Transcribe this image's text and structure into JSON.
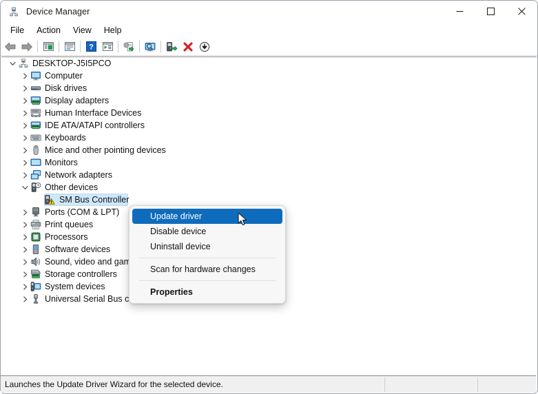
{
  "window": {
    "title": "Device Manager",
    "icon": "device-manager-icon",
    "controls": {
      "minimize": "minimize-icon",
      "maximize": "maximize-icon",
      "close": "close-icon"
    }
  },
  "menubar": {
    "items": [
      {
        "label": "File"
      },
      {
        "label": "Action"
      },
      {
        "label": "View"
      },
      {
        "label": "Help"
      }
    ]
  },
  "toolbar": {
    "buttons": [
      {
        "name": "back-icon",
        "title": "Back"
      },
      {
        "name": "forward-icon",
        "title": "Forward"
      },
      {
        "separator": true
      },
      {
        "name": "show-hide-console-tree-icon",
        "title": "Show/Hide Console Tree"
      },
      {
        "separator": true
      },
      {
        "name": "properties-icon",
        "title": "Properties"
      },
      {
        "separator": true
      },
      {
        "name": "help-icon",
        "title": "Help"
      },
      {
        "name": "show-hide-action-pane-icon",
        "title": "Show/Hide Action Pane"
      },
      {
        "separator": true
      },
      {
        "name": "update-driver-icon",
        "title": "Update driver"
      },
      {
        "separator": true
      },
      {
        "name": "scan-for-hardware-changes-icon",
        "title": "Scan for hardware changes"
      },
      {
        "separator": true
      },
      {
        "name": "enable-device-icon",
        "title": "Enable device"
      },
      {
        "name": "uninstall-device-icon",
        "title": "Uninstall device"
      },
      {
        "name": "disable-device-icon",
        "title": "Disable device"
      }
    ]
  },
  "tree": {
    "nodes": [
      {
        "label": "DESKTOP-J5I5PCO",
        "icon": "computer-root-icon",
        "depth": 0,
        "expander": "expanded",
        "selected": false
      },
      {
        "label": "Computer",
        "icon": "computer-icon",
        "depth": 1,
        "expander": "collapsed",
        "selected": false
      },
      {
        "label": "Disk drives",
        "icon": "disk-drive-icon",
        "depth": 1,
        "expander": "collapsed",
        "selected": false
      },
      {
        "label": "Display adapters",
        "icon": "display-adapter-icon",
        "depth": 1,
        "expander": "collapsed",
        "selected": false
      },
      {
        "label": "Human Interface Devices",
        "icon": "human-interface-device-icon",
        "depth": 1,
        "expander": "collapsed",
        "selected": false
      },
      {
        "label": "IDE ATA/ATAPI controllers",
        "icon": "ide-controller-icon",
        "depth": 1,
        "expander": "collapsed",
        "selected": false
      },
      {
        "label": "Keyboards",
        "icon": "keyboard-icon",
        "depth": 1,
        "expander": "collapsed",
        "selected": false
      },
      {
        "label": "Mice and other pointing devices",
        "icon": "mouse-icon",
        "depth": 1,
        "expander": "collapsed",
        "selected": false
      },
      {
        "label": "Monitors",
        "icon": "monitor-icon",
        "depth": 1,
        "expander": "collapsed",
        "selected": false
      },
      {
        "label": "Network adapters",
        "icon": "network-adapter-icon",
        "depth": 1,
        "expander": "collapsed",
        "selected": false
      },
      {
        "label": "Other devices",
        "icon": "other-device-icon",
        "depth": 1,
        "expander": "expanded",
        "selected": false
      },
      {
        "label": "SM Bus Controller",
        "icon": "unknown-device-warning-icon",
        "depth": 2,
        "expander": "none",
        "selected": true
      },
      {
        "label": "Ports (COM & LPT)",
        "icon": "port-icon",
        "depth": 1,
        "expander": "collapsed",
        "selected": false
      },
      {
        "label": "Print queues",
        "icon": "printer-icon",
        "depth": 1,
        "expander": "collapsed",
        "selected": false
      },
      {
        "label": "Processors",
        "icon": "processor-icon",
        "depth": 1,
        "expander": "collapsed",
        "selected": false
      },
      {
        "label": "Software devices",
        "icon": "software-device-icon",
        "depth": 1,
        "expander": "collapsed",
        "selected": false
      },
      {
        "label": "Sound, video and game controllers",
        "icon": "sound-device-icon",
        "depth": 1,
        "expander": "collapsed",
        "selected": false
      },
      {
        "label": "Storage controllers",
        "icon": "storage-controller-icon",
        "depth": 1,
        "expander": "collapsed",
        "selected": false
      },
      {
        "label": "System devices",
        "icon": "system-device-icon",
        "depth": 1,
        "expander": "collapsed",
        "selected": false
      },
      {
        "label": "Universal Serial Bus controllers",
        "icon": "usb-controller-icon",
        "depth": 1,
        "expander": "collapsed",
        "selected": false
      }
    ]
  },
  "context_menu": {
    "items": [
      {
        "label": "Update driver",
        "highlight": true,
        "bold": false
      },
      {
        "label": "Disable device",
        "highlight": false,
        "bold": false
      },
      {
        "label": "Uninstall device",
        "highlight": false,
        "bold": false
      },
      {
        "separator": true
      },
      {
        "label": "Scan for hardware changes",
        "highlight": false,
        "bold": false
      },
      {
        "separator": true
      },
      {
        "label": "Properties",
        "highlight": false,
        "bold": true
      }
    ]
  },
  "statusbar": {
    "message": "Launches the Update Driver Wizard for the selected device.",
    "pane2": "",
    "pane3": ""
  },
  "colors": {
    "highlight_blue": "#0f6cbd",
    "selection_blue": "#cfe8fc",
    "window_border": "#9aa3ad",
    "statusbar_bg": "#f0f0f0",
    "menu_bg": "#f7f7f7"
  }
}
